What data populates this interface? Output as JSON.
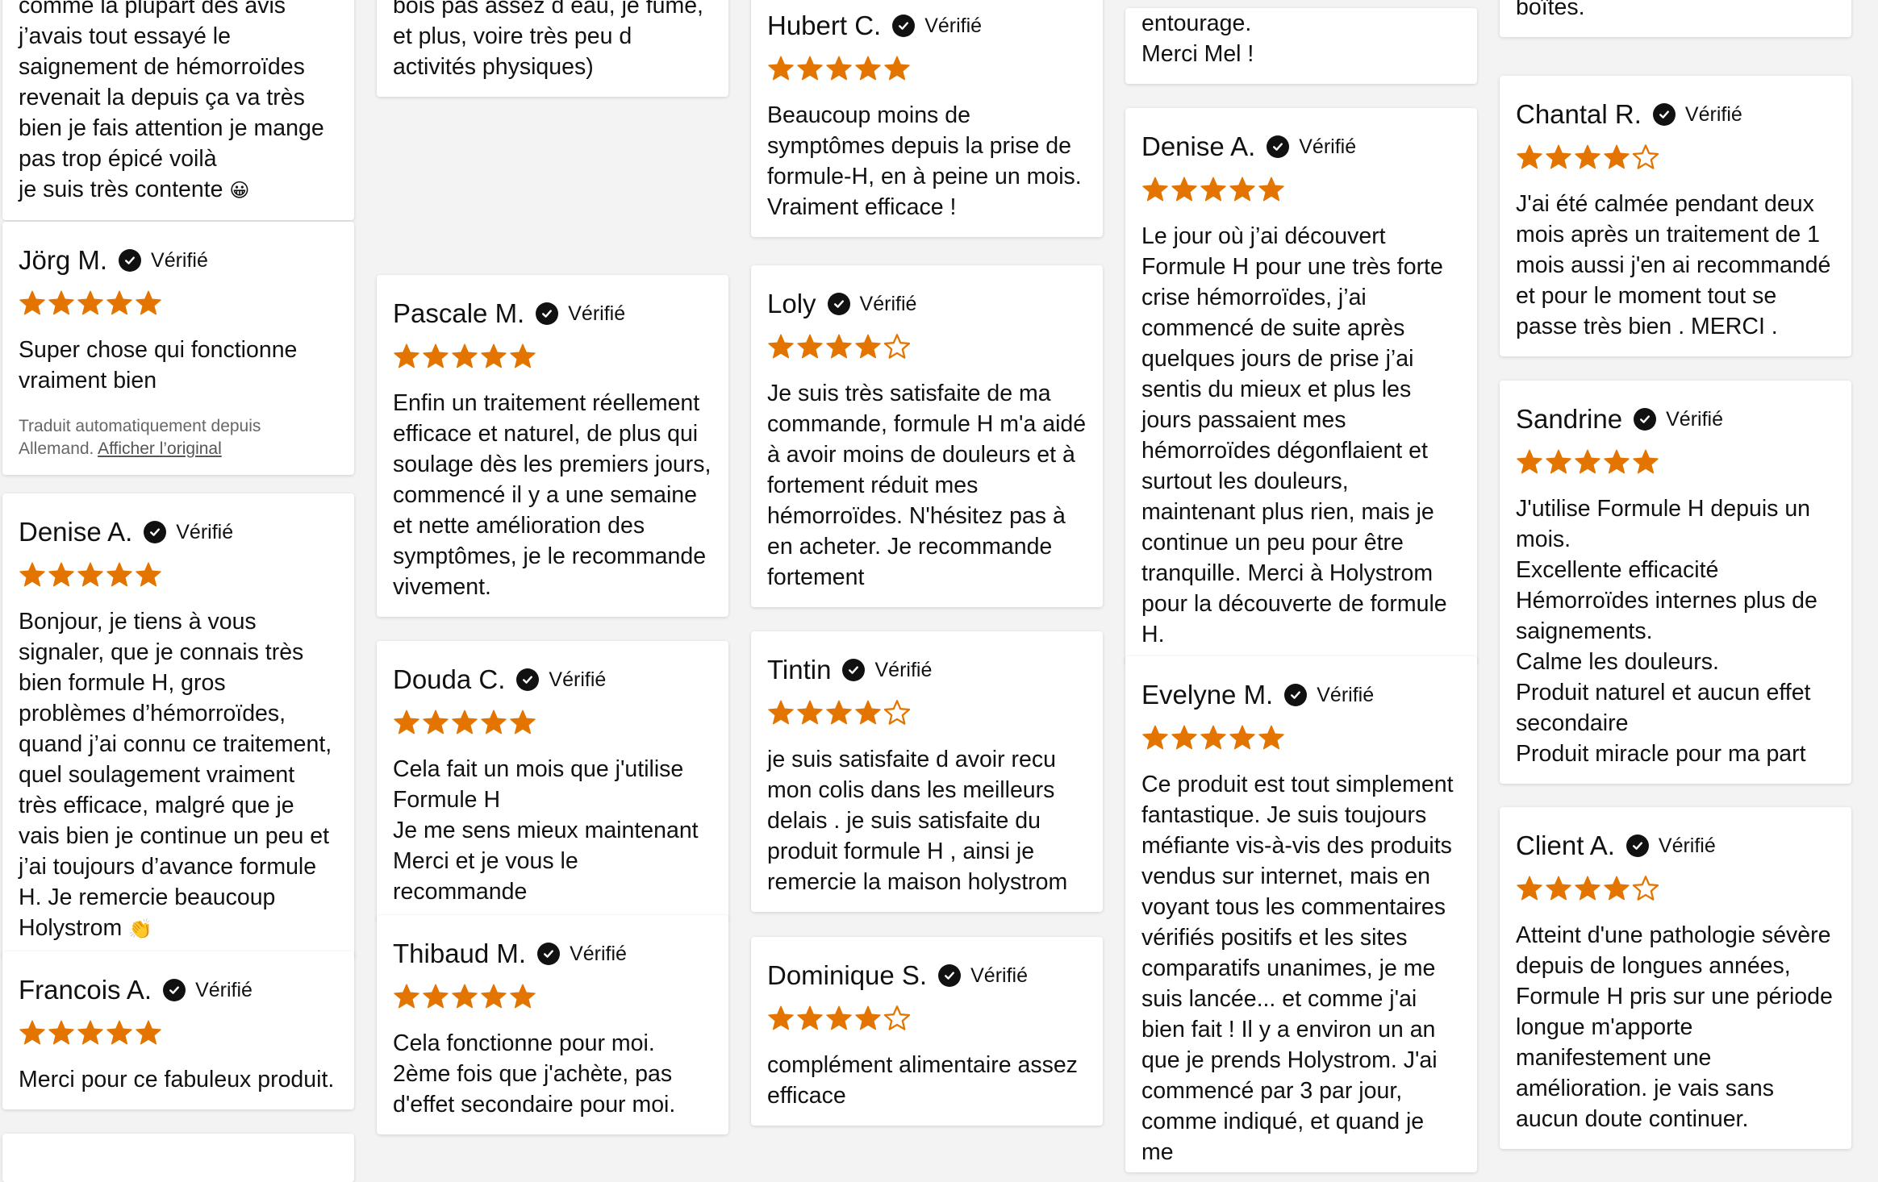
{
  "verified_label": "Vérifié",
  "star_color": "#e37400",
  "translation": {
    "note": "Traduit automatiquement depuis Allemand.",
    "link": "Afficher l’original"
  },
  "reviews": {
    "c1_top": {
      "text": "comme la plupart des avis j’avais tout essayé le saignement de hémorroïdes revenait la depuis ça va très bien je fais attention je mange pas trop épicé voilà\nje suis très contente",
      "emoji": "😀"
    },
    "jorg": {
      "name": "Jörg M.",
      "rating": 5,
      "text": "Super chose qui fonctionne vraiment bien"
    },
    "denise1": {
      "name": "Denise A.",
      "rating": 5,
      "text": "Bonjour, je tiens à vous signaler, que je connais très bien formule H, gros problèmes d’hémorroïdes, quand j’ai connu ce traitement, quel soulagement vraiment très efficace, malgré que je vais bien je continue un peu et j’ai toujours d’avance formule H. Je remercie beaucoup Holystrom",
      "emoji": "👏"
    },
    "francois": {
      "name": "Francois A.",
      "rating": 5,
      "text": "Merci pour ce fabuleux produit."
    },
    "c2_top": {
      "text": "bois pas assez d eau, je fume, et plus, voire très peu d activités physiques)"
    },
    "pascale": {
      "name": "Pascale M.",
      "rating": 5,
      "text": "Enfin un traitement réellement efficace et naturel, de plus qui soulage dès les premiers jours, commencé il y a une semaine et nette amélioration des symptômes, je le recommande vivement."
    },
    "douda": {
      "name": "Douda C.",
      "rating": 5,
      "text": "Cela fait un mois que j'utilise Formule H\nJe me sens mieux maintenant\nMerci et je vous le recommande"
    },
    "thibaud": {
      "name": "Thibaud M.",
      "rating": 5,
      "text": "Cela fonctionne pour moi. 2ème fois que j'achète, pas d'effet secondaire pour moi."
    },
    "hubert": {
      "name": "Hubert C.",
      "rating": 5,
      "text": "Beaucoup moins de symptômes depuis la prise de formule-H, en à peine un mois. Vraiment efficace !"
    },
    "loly": {
      "name": "Loly",
      "rating": 4,
      "text": "Je suis très satisfaite de ma commande, formule H m'a aidé à avoir moins de douleurs et à fortement réduit mes hémorroïdes. N'hésitez pas à en acheter. Je recommande fortement"
    },
    "tintin": {
      "name": "Tintin",
      "rating": 4,
      "text": "je suis satisfaite d avoir recu mon colis dans les meilleurs delais . je suis satisfaite du produit formule H , ainsi je remercie la maison holystrom"
    },
    "dominique": {
      "name": "Dominique S.",
      "rating": 4,
      "text": "complément alimentaire assez efficace"
    },
    "c4_top": {
      "text": "entourage.\nMerci Mel !"
    },
    "denise2": {
      "name": "Denise A.",
      "rating": 5,
      "text": "Le jour où j’ai découvert Formule H pour une très forte crise hémorroïdes, j’ai commencé de suite après quelques jours de prise j’ai sentis du mieux et plus les jours passaient mes hémorroïdes dégonflaient et surtout les douleurs, maintenant plus rien, mais je continue un peu pour être tranquille. Merci à Holystrom pour la découverte de formule H."
    },
    "evelyne": {
      "name": "Evelyne M.",
      "rating": 5,
      "text": "Ce produit est tout simplement fantastique. Je suis toujours méfiante vis-à-vis des produits vendus sur internet, mais en voyant tous les commentaires vérifiés positifs et les sites comparatifs unanimes, je me suis lancée... et comme j'ai bien fait ! Il y a environ un an que je prends Holystrom. J'ai commencé par 3 par jour, comme indiqué, et quand je me"
    },
    "c5_top": {
      "text": "boîtes."
    },
    "chantal": {
      "name": "Chantal R.",
      "rating": 4,
      "text": "J'ai été calmée pendant deux mois après un traitement de 1 mois aussi j'en ai recommandé et pour le moment tout se passe très bien .  MERCI ."
    },
    "sandrine": {
      "name": "Sandrine",
      "rating": 5,
      "text": "J'utilise Formule H depuis un mois.\nExcellente efficacité\nHémorroïdes internes plus de saignements.\nCalme les douleurs.\nProduit naturel et aucun effet secondaire\nProduit miracle pour ma part"
    },
    "client": {
      "name": "Client A.",
      "rating": 4,
      "text": "Atteint d'une pathologie sévère depuis de longues années, Formule H pris sur une période longue m'apporte manifestement une amélioration. je vais sans aucun doute continuer."
    }
  }
}
